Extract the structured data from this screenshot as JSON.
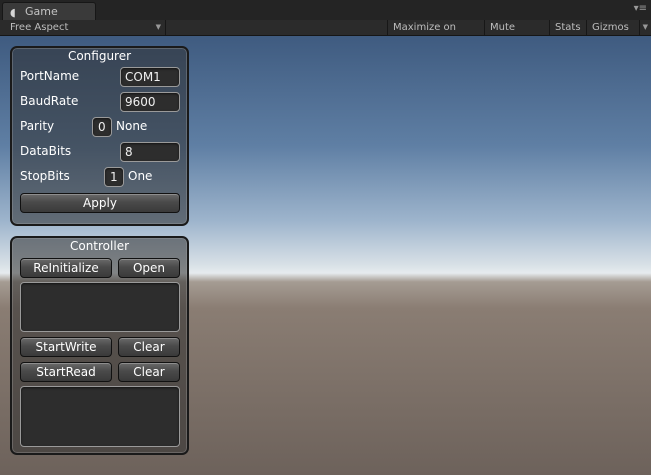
{
  "window": {
    "tab_title": "Game",
    "tab_icon": "pacman-icon",
    "menu_icon": "▾≡"
  },
  "toolbar": {
    "aspect": "Free Aspect",
    "maximize_on_play": "Maximize on Play",
    "mute_audio": "Mute audio",
    "stats": "Stats",
    "gizmos": "Gizmos"
  },
  "configurer": {
    "title": "Configurer",
    "port_name_label": "PortName",
    "port_name_value": "COM1",
    "baud_rate_label": "BaudRate",
    "baud_rate_value": "9600",
    "parity_label": "Parity",
    "parity_value": "0",
    "parity_text": "None",
    "data_bits_label": "DataBits",
    "data_bits_value": "8",
    "stop_bits_label": "StopBits",
    "stop_bits_value": "1",
    "stop_bits_text": "One",
    "apply_label": "Apply"
  },
  "controller": {
    "title": "Controller",
    "reinitialize_label": "ReInitialize",
    "open_label": "Open",
    "start_write_label": "StartWrite",
    "clear_write_label": "Clear",
    "start_read_label": "StartRead",
    "clear_read_label": "Clear",
    "write_text": "",
    "read_text": ""
  }
}
